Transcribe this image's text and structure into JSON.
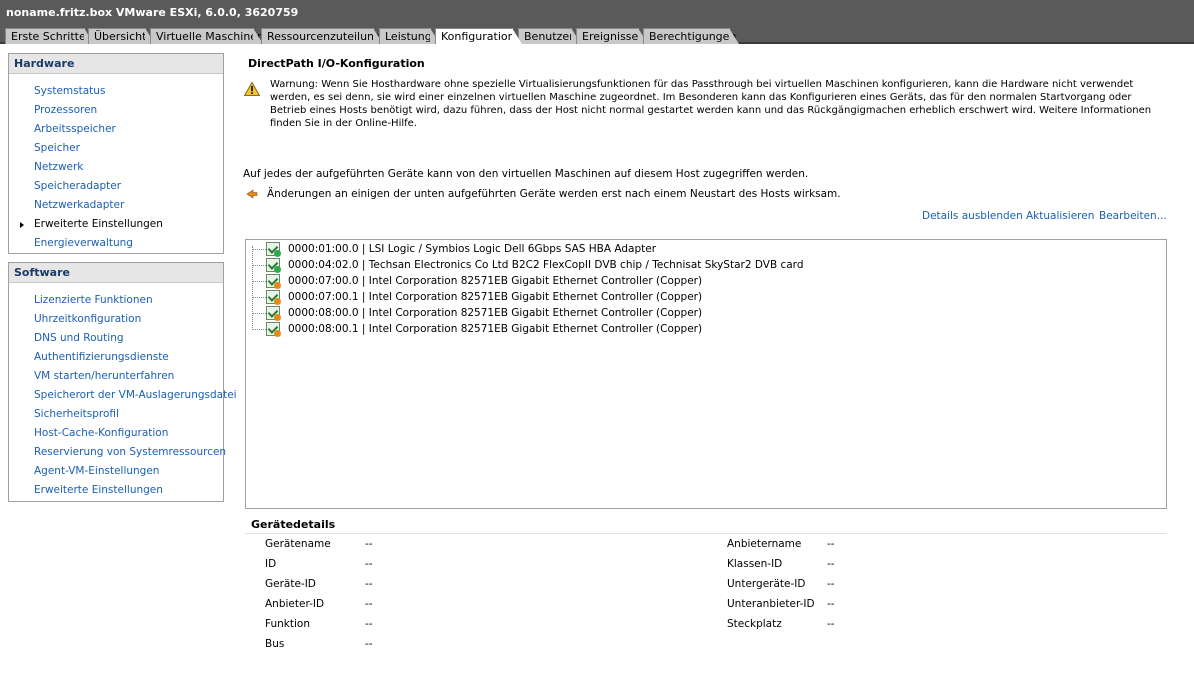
{
  "window": {
    "title": "noname.fritz.box VMware ESXi, 6.0.0, 3620759"
  },
  "tabs": [
    {
      "label": "Erste Schritte"
    },
    {
      "label": "Übersicht"
    },
    {
      "label": "Virtuelle Maschinen"
    },
    {
      "label": "Ressourcenzuteilung"
    },
    {
      "label": "Leistung"
    },
    {
      "label": "Konfiguration"
    },
    {
      "label": "Benutzer"
    },
    {
      "label": "Ereignisse"
    },
    {
      "label": "Berechtigungen"
    }
  ],
  "hardware": {
    "heading": "Hardware",
    "items": [
      {
        "label": "Systemstatus"
      },
      {
        "label": "Prozessoren"
      },
      {
        "label": "Arbeitsspeicher"
      },
      {
        "label": "Speicher"
      },
      {
        "label": "Netzwerk"
      },
      {
        "label": "Speicheradapter"
      },
      {
        "label": "Netzwerkadapter"
      },
      {
        "label": "Erweiterte Einstellungen"
      },
      {
        "label": "Energieverwaltung"
      }
    ]
  },
  "software": {
    "heading": "Software",
    "items": [
      {
        "label": "Lizenzierte Funktionen"
      },
      {
        "label": "Uhrzeitkonfiguration"
      },
      {
        "label": "DNS und Routing"
      },
      {
        "label": "Authentifizierungsdienste"
      },
      {
        "label": "VM starten/herunterfahren"
      },
      {
        "label": "Speicherort der VM-Auslagerungsdatei"
      },
      {
        "label": "Sicherheitsprofil"
      },
      {
        "label": "Host-Cache-Konfiguration"
      },
      {
        "label": "Reservierung von Systemressourcen"
      },
      {
        "label": "Agent-VM-Einstellungen"
      },
      {
        "label": "Erweiterte Einstellungen"
      }
    ]
  },
  "main": {
    "title": "DirectPath I/O-Konfiguration",
    "warning": "Warnung: Wenn Sie Hosthardware ohne spezielle Virtualisierungsfunktionen für das Passthrough bei virtuellen Maschinen konfigurieren, kann die Hardware nicht verwendet werden, es sei denn, sie wird einer einzelnen virtuellen Maschine zugeordnet. Im Besonderen kann das Konfigurieren eines Geräts, das für den normalen Startvorgang oder Betrieb eines Hosts benötigt wird, dazu führen, dass der Host nicht normal gestartet werden kann und das Rückgängigmachen erheblich erschwert wird. Weitere Informationen finden Sie in der Online-Hilfe.",
    "info": "Auf jedes der aufgeführten Geräte kann von den virtuellen Maschinen auf diesem Host zugegriffen werden.",
    "restart_note": "Änderungen an einigen der unten aufgeführten Geräte werden erst nach einem Neustart des Hosts wirksam.",
    "links": {
      "hide_details": "Details ausblenden",
      "refresh": "Aktualisieren",
      "edit": "Bearbeiten..."
    },
    "devices": [
      {
        "label": "0000:01:00.0 | LSI Logic / Symbios Logic Dell 6Gbps SAS HBA Adapter",
        "status": "active"
      },
      {
        "label": "0000:04:02.0 | Techsan Electronics Co Ltd B2C2 FlexCopII DVB chip / Technisat SkyStar2 DVB card",
        "status": "active"
      },
      {
        "label": "0000:07:00.0 | Intel Corporation 82571EB Gigabit Ethernet Controller (Copper)",
        "status": "pending"
      },
      {
        "label": "0000:07:00.1 | Intel Corporation 82571EB Gigabit Ethernet Controller (Copper)",
        "status": "pending"
      },
      {
        "label": "0000:08:00.0 | Intel Corporation 82571EB Gigabit Ethernet Controller (Copper)",
        "status": "pending"
      },
      {
        "label": "0000:08:00.1 | Intel Corporation 82571EB Gigabit Ethernet Controller (Copper)",
        "status": "pending"
      }
    ],
    "details": {
      "heading": "Gerätedetails",
      "left": [
        {
          "label": "Gerätename",
          "value": "--"
        },
        {
          "label": "ID",
          "value": "--"
        },
        {
          "label": "Geräte-ID",
          "value": "--"
        },
        {
          "label": "Anbieter-ID",
          "value": "--"
        },
        {
          "label": "Funktion",
          "value": "--"
        },
        {
          "label": "Bus",
          "value": "--"
        }
      ],
      "right": [
        {
          "label": "Anbietername",
          "value": "--"
        },
        {
          "label": "Klassen-ID",
          "value": "--"
        },
        {
          "label": "Untergeräte-ID",
          "value": "--"
        },
        {
          "label": "Unteranbieter-ID",
          "value": "--"
        },
        {
          "label": "Steckplatz",
          "value": "--"
        }
      ]
    }
  },
  "colors": {
    "active_dot": "#2fa84f",
    "pending_dot": "#e08a1e",
    "link": "#1a5fb4"
  }
}
